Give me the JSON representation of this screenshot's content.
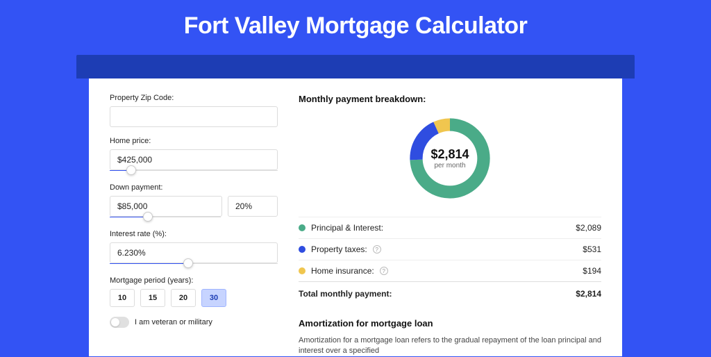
{
  "title": "Fort Valley Mortgage Calculator",
  "form": {
    "zip": {
      "label": "Property Zip Code:",
      "value": ""
    },
    "price": {
      "label": "Home price:",
      "value": "$425,000",
      "slider_percent": 10
    },
    "down": {
      "label": "Down payment:",
      "amount": "$85,000",
      "percent": "20%",
      "slider_percent": 30
    },
    "rate": {
      "label": "Interest rate (%):",
      "value": "6.230%",
      "slider_percent": 44
    },
    "period": {
      "label": "Mortgage period (years):",
      "options": [
        "10",
        "15",
        "20",
        "30"
      ],
      "active": "30"
    },
    "veteran": {
      "label": "I am veteran or military",
      "value": false
    }
  },
  "breakdown": {
    "heading": "Monthly payment breakdown:",
    "center_amount": "$2,814",
    "center_sub": "per month",
    "items": [
      {
        "label": "Principal & Interest:",
        "value": "$2,089",
        "color": "green"
      },
      {
        "label": "Property taxes:",
        "value": "$531",
        "color": "blue",
        "info": true
      },
      {
        "label": "Home insurance:",
        "value": "$194",
        "color": "yellow",
        "info": true
      }
    ],
    "total_label": "Total monthly payment:",
    "total_value": "$2,814"
  },
  "amort": {
    "heading": "Amortization for mortgage loan",
    "text": "Amortization for a mortgage loan refers to the gradual repayment of the loan principal and interest over a specified"
  },
  "chart_data": {
    "type": "pie",
    "title": "Monthly payment breakdown",
    "categories": [
      "Principal & Interest",
      "Property taxes",
      "Home insurance"
    ],
    "values": [
      2089,
      531,
      194
    ],
    "total": 2814
  }
}
